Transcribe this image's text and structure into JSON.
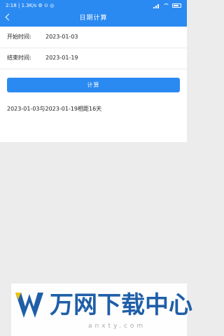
{
  "status_bar": {
    "time": "2:18",
    "speed": "1.3K/s",
    "icons": [
      "signal-icon",
      "wifi-icon",
      "battery-icon"
    ]
  },
  "nav": {
    "title": "日期计算",
    "back_icon": "chevron-left-icon"
  },
  "form": {
    "start_label": "开始时间:",
    "start_value": "2023-01-03",
    "end_label": "结束时间:",
    "end_value": "2023-01-19"
  },
  "actions": {
    "calculate_label": "计算"
  },
  "result": {
    "text": "2023-01-03与2023-01-19相距16天"
  },
  "watermark": {
    "brand": "万网下载中心",
    "url": "anxty.com"
  },
  "colors": {
    "primary": "#2b8af2",
    "background": "#ececec",
    "surface": "#ffffff"
  }
}
